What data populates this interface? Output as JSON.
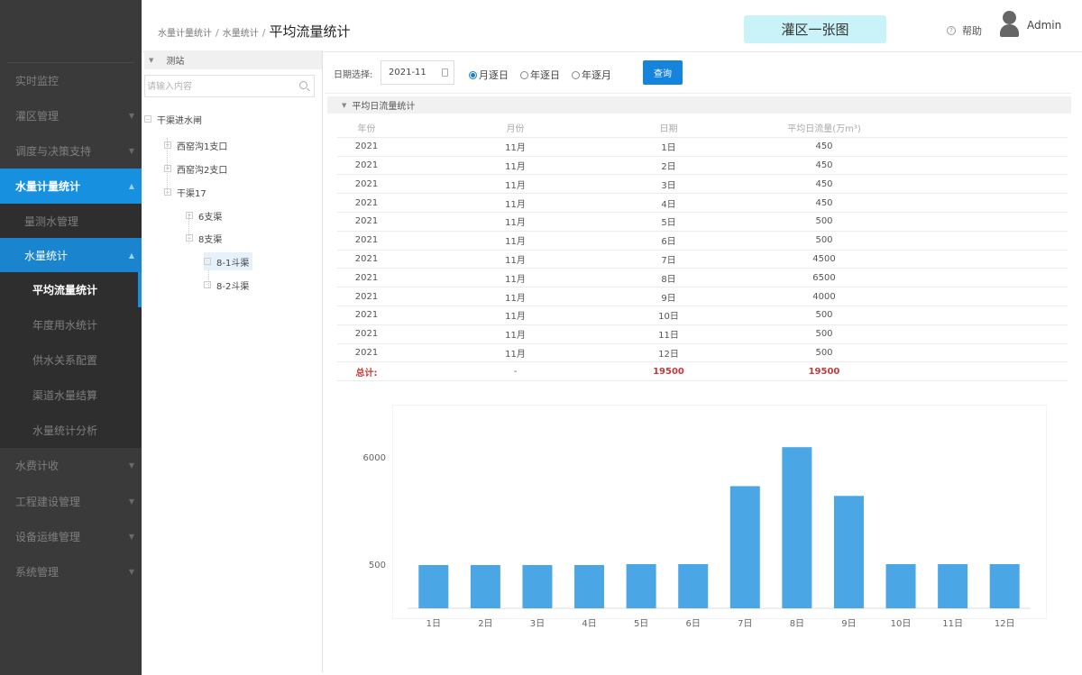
{
  "sidebar": {
    "items": [
      {
        "label": "实时监控",
        "has_arrow": false
      },
      {
        "label": "灌区管理",
        "has_arrow": true
      },
      {
        "label": "调度与决策支持",
        "has_arrow": true
      },
      {
        "label": "水量计量统计",
        "has_arrow": true
      },
      {
        "label": "量测水管理",
        "has_arrow": false
      },
      {
        "label": "水量统计",
        "has_arrow": true
      },
      {
        "label": "平均流量统计",
        "has_arrow": false
      },
      {
        "label": "年度用水统计",
        "has_arrow": false
      },
      {
        "label": "供水关系配置",
        "has_arrow": false
      },
      {
        "label": "渠道水量结算",
        "has_arrow": false
      },
      {
        "label": "水量统计分析",
        "has_arrow": false
      },
      {
        "label": "水费计收",
        "has_arrow": true
      },
      {
        "label": "工程建设管理",
        "has_arrow": true
      },
      {
        "label": "设备运维管理",
        "has_arrow": true
      },
      {
        "label": "系统管理",
        "has_arrow": true
      }
    ]
  },
  "header": {
    "breadcrumb": [
      "水量计量统计",
      "水量统计"
    ],
    "separator": "/",
    "current": "平均流量统计",
    "map_button": "灌区一张图",
    "help_label": "帮助",
    "help_icon": "?",
    "user_name": "Admin"
  },
  "tree": {
    "title": "测站",
    "search_placeholder": "请输入内容",
    "nodes": [
      {
        "label": "干渠进水闸"
      },
      {
        "label": "西窑沟1支口"
      },
      {
        "label": "西窑沟2支口"
      },
      {
        "label": "干渠17"
      },
      {
        "label": "6支渠"
      },
      {
        "label": "8支渠"
      },
      {
        "label": "8-1斗渠"
      },
      {
        "label": "8-2斗渠"
      }
    ],
    "selected": "8-1斗渠"
  },
  "filter": {
    "date_label": "日期选择:",
    "date_value": "2021-11",
    "radios": [
      "月逐日",
      "年逐日",
      "年逐月"
    ],
    "selected_radio": "月逐日",
    "query_button": "查询"
  },
  "section": {
    "title": "平均日流量统计"
  },
  "table": {
    "headers": [
      "年份",
      "月份",
      "日期",
      "平均日流量(万m³)"
    ],
    "rows": [
      [
        "2021",
        "11月",
        "1日",
        "450"
      ],
      [
        "2021",
        "11月",
        "2日",
        "450"
      ],
      [
        "2021",
        "11月",
        "3日",
        "450"
      ],
      [
        "2021",
        "11月",
        "4日",
        "450"
      ],
      [
        "2021",
        "11月",
        "5日",
        "500"
      ],
      [
        "2021",
        "11月",
        "6日",
        "500"
      ],
      [
        "2021",
        "11月",
        "7日",
        "4500"
      ],
      [
        "2021",
        "11月",
        "8日",
        "6500"
      ],
      [
        "2021",
        "11月",
        "9日",
        "4000"
      ],
      [
        "2021",
        "11月",
        "10日",
        "500"
      ],
      [
        "2021",
        "11月",
        "11日",
        "500"
      ],
      [
        "2021",
        "11月",
        "12日",
        "500"
      ]
    ],
    "total_row": [
      "总计:",
      "-",
      "19500",
      "19500"
    ]
  },
  "colors": {
    "sidebar_bg": "#3a3a3a",
    "active_blue": "#1790e0",
    "bar_color": "#4ba6e6",
    "total_red": "#c23a3a",
    "map_button_bg": "#c9f3f9"
  },
  "chart_data": {
    "type": "bar",
    "categories": [
      "1日",
      "2日",
      "3日",
      "4日",
      "5日",
      "6日",
      "7日",
      "8日",
      "9日",
      "10日",
      "11日",
      "12日"
    ],
    "values": [
      450,
      450,
      450,
      450,
      500,
      500,
      4500,
      6500,
      4000,
      500,
      500,
      500
    ],
    "y_ticks": [
      500,
      6000
    ],
    "title": "",
    "xlabel": "",
    "ylabel": "",
    "grid": false,
    "legend": "none"
  }
}
